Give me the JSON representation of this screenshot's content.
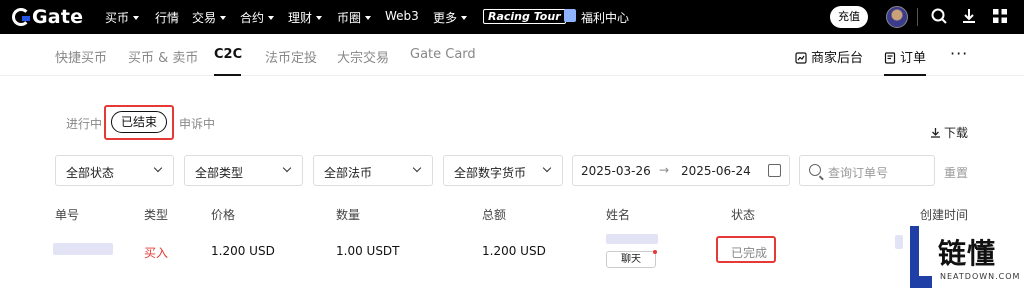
{
  "topnav": {
    "logo": "Gate",
    "menu": [
      {
        "label": "买币",
        "caret": true
      },
      {
        "label": "行情",
        "caret": false
      },
      {
        "label": "交易",
        "caret": true
      },
      {
        "label": "合约",
        "caret": true
      },
      {
        "label": "理财",
        "caret": true
      },
      {
        "label": "币圈",
        "caret": true
      },
      {
        "label": "Web3",
        "caret": false
      },
      {
        "label": "更多",
        "caret": true
      }
    ],
    "racing_badge": "Racing Tour",
    "welfare": "福利中心",
    "recharge": "充值",
    "icons": [
      "search-icon",
      "download-icon",
      "grid-icon"
    ]
  },
  "subnav": {
    "tabs": [
      "快捷买币",
      "买币 & 卖币",
      "C2C",
      "法币定投",
      "大宗交易",
      "Gate Card"
    ],
    "active_tab": "C2C",
    "merchant": "商家后台",
    "orders": "订单",
    "more": "···"
  },
  "status_tabs": {
    "in_progress": "进行中",
    "ended": "已结束",
    "appeal": "申诉中",
    "active": "已结束"
  },
  "download": "下载",
  "filters": {
    "status": "全部状态",
    "type": "全部类型",
    "fiat": "全部法币",
    "crypto": "全部数字货币",
    "date_from": "2025-03-26",
    "date_arrow": "→",
    "date_to": "2025-06-24",
    "search_placeholder": "查询订单号",
    "reset": "重置"
  },
  "table": {
    "headers": [
      "单号",
      "类型",
      "价格",
      "数量",
      "总额",
      "姓名",
      "状态",
      "创建时间"
    ],
    "rows": [
      {
        "type": "买入",
        "price": "1.200 USD",
        "quantity": "1.00 USDT",
        "total": "1.200 USD",
        "chat": "聊天",
        "status": "已完成"
      }
    ]
  },
  "watermark": {
    "main": "链懂",
    "sub": "NEATDOWN.COM"
  },
  "colors": {
    "brand_blue": "#2354e6",
    "buy_red": "#e53935",
    "highlight_red": "#e53935"
  }
}
